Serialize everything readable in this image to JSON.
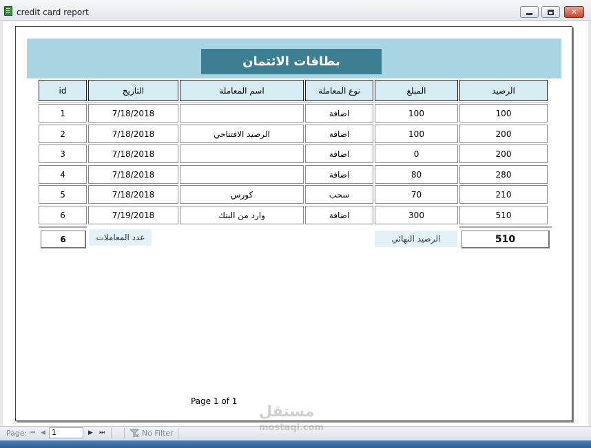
{
  "window": {
    "title": "credit card report",
    "minimize_glyph": "",
    "maximize_glyph": "",
    "close_glyph": "✕"
  },
  "report": {
    "title": "بطاقات الائتمان",
    "columns": {
      "balance": "الرصيد",
      "amount": "المبلغ",
      "type": "نوع المعاملة",
      "name": "اسم المعاملة",
      "date": "التاريخ",
      "id": "id"
    },
    "rows": [
      {
        "balance": "100",
        "amount": "100",
        "type": "اضافة",
        "name": "",
        "date": "7/18/2018",
        "id": "1"
      },
      {
        "balance": "200",
        "amount": "100",
        "type": "اضافة",
        "name": "الرصيد الافتتاحي",
        "date": "7/18/2018",
        "id": "2"
      },
      {
        "balance": "200",
        "amount": "0",
        "type": "اضافة",
        "name": "",
        "date": "7/18/2018",
        "id": "3"
      },
      {
        "balance": "280",
        "amount": "80",
        "type": "اضافة",
        "name": "",
        "date": "7/18/2018",
        "id": "4"
      },
      {
        "balance": "210",
        "amount": "70",
        "type": "سحب",
        "name": "كورس",
        "date": "7/18/2018",
        "id": "5"
      },
      {
        "balance": "510",
        "amount": "300",
        "type": "اضافة",
        "name": "وارد  من البنك",
        "date": "7/19/2018",
        "id": "6"
      }
    ],
    "footer": {
      "count_label": "عدد المعاملات",
      "count_value": "6",
      "final_balance_label": "الرصيد النهائي",
      "final_balance_value": "510"
    },
    "page_number": "Page 1 of 1"
  },
  "statusbar": {
    "page_label": "Page:",
    "first": "⏮",
    "prev": "◀",
    "page_value": "1",
    "next": "▶",
    "last": "⏭",
    "filter_label": "No Filter"
  },
  "watermark": {
    "logo_text": "مستقل",
    "sub_text": "mostaql.com"
  },
  "colors": {
    "header_band": "#a9d5e3",
    "title_bg": "#3c7f92",
    "column_header_bg": "#d6ecf3",
    "label_bg": "#e3f2f7"
  }
}
